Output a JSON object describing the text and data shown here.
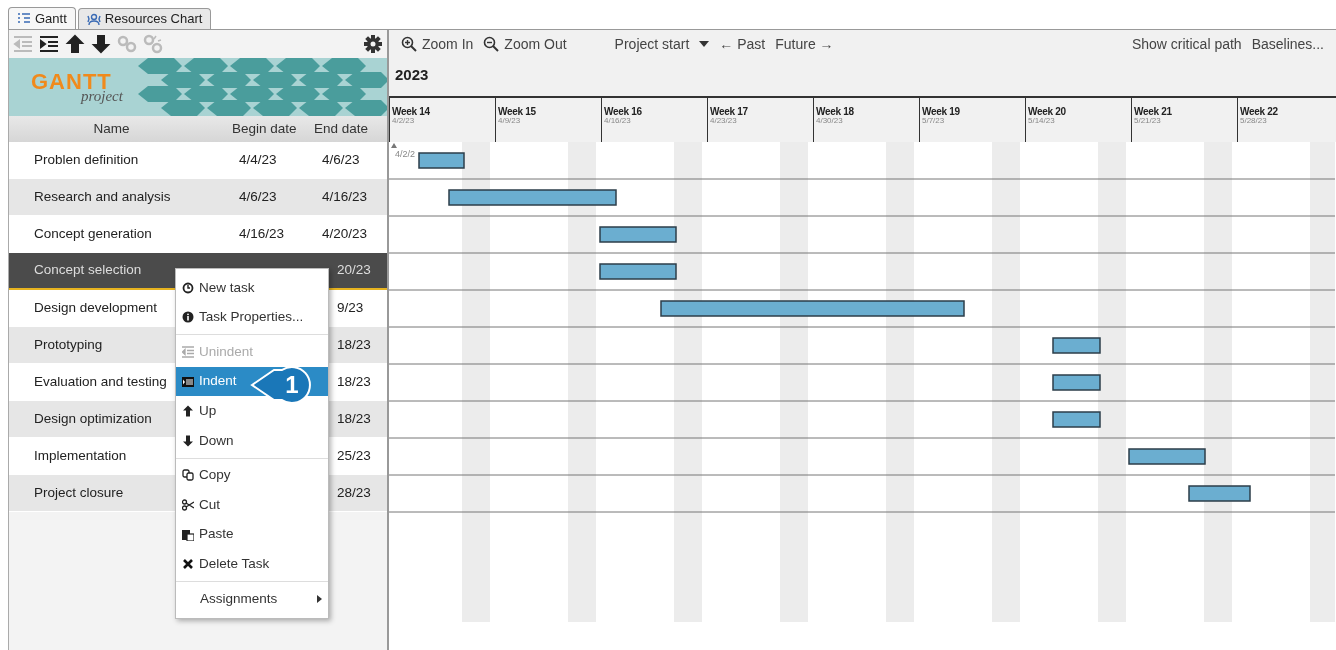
{
  "tabs": [
    {
      "label": "Gantt",
      "selected": true
    },
    {
      "label": "Resources Chart",
      "selected": false
    }
  ],
  "left_toolbar": [
    {
      "disabled": true
    },
    {
      "disabled": false
    },
    {
      "disabled": false
    },
    {
      "disabled": false
    },
    {
      "disabled": true
    },
    {
      "disabled": true
    }
  ],
  "logo": {
    "word": "GANTT",
    "sub": "project"
  },
  "table": {
    "columns": [
      "Name",
      "Begin date",
      "End date"
    ],
    "rows": [
      {
        "name": "Problen definition",
        "begin": "4/4/23",
        "end": "4/6/23",
        "selected": false
      },
      {
        "name": "Research and analysis",
        "begin": "4/6/23",
        "end": "4/16/23",
        "selected": false
      },
      {
        "name": "Concept generation",
        "begin": "4/16/23",
        "end": "4/20/23",
        "selected": false
      },
      {
        "name": "Concept selection",
        "end": "20/23",
        "selected": true
      },
      {
        "name": "Design development",
        "end": "9/23",
        "selected": false
      },
      {
        "name": "Prototyping",
        "end": "18/23",
        "selected": false
      },
      {
        "name": "Evaluation and testing",
        "end": "18/23",
        "selected": false
      },
      {
        "name": "Design optimization",
        "end": "18/23",
        "selected": false
      },
      {
        "name": "Implementation",
        "end": "25/23",
        "selected": false
      },
      {
        "name": "Project closure",
        "end": "28/23",
        "selected": false
      }
    ]
  },
  "chart_toolbar": {
    "zoom_in": "Zoom In",
    "zoom_out": "Zoom Out",
    "project_start": "Project start",
    "past": "← Past",
    "future": "Future →",
    "critical_path": "Show critical path",
    "baselines": "Baselines..."
  },
  "year": "2023",
  "weeks": [
    {
      "label": "Week 14",
      "date": "4/2/23"
    },
    {
      "label": "Week 15",
      "date": "4/9/23"
    },
    {
      "label": "Week 16",
      "date": "4/16/23"
    },
    {
      "label": "Week 17",
      "date": "4/23/23"
    },
    {
      "label": "Week 18",
      "date": "4/30/23"
    },
    {
      "label": "Week 19",
      "date": "5/7/23"
    },
    {
      "label": "Week 20",
      "date": "5/14/23"
    },
    {
      "label": "Week 21",
      "date": "5/21/23"
    },
    {
      "label": "Week 22",
      "date": "5/28/23"
    }
  ],
  "start_marker": "4/2/2",
  "context_menu": [
    {
      "kind": "item",
      "label": "New task",
      "disabled": false,
      "selected": false
    },
    {
      "kind": "item",
      "label": "Task Properties...",
      "disabled": false,
      "selected": false
    },
    {
      "kind": "separator"
    },
    {
      "kind": "item",
      "label": "Unindent",
      "disabled": true,
      "selected": false
    },
    {
      "kind": "item",
      "label": "Indent",
      "disabled": false,
      "selected": true
    },
    {
      "kind": "item",
      "label": "Up",
      "disabled": false,
      "selected": false
    },
    {
      "kind": "item",
      "label": "Down",
      "disabled": false,
      "selected": false
    },
    {
      "kind": "separator"
    },
    {
      "kind": "item",
      "label": "Copy",
      "disabled": false,
      "selected": false
    },
    {
      "kind": "item",
      "label": "Cut",
      "disabled": false,
      "selected": false
    },
    {
      "kind": "item",
      "label": "Paste",
      "disabled": false,
      "selected": false
    },
    {
      "kind": "item",
      "label": "Delete Task",
      "disabled": false,
      "selected": false
    },
    {
      "kind": "separator"
    },
    {
      "kind": "submenu",
      "label": "Assignments",
      "disabled": false,
      "selected": false
    }
  ],
  "callout": "1"
}
